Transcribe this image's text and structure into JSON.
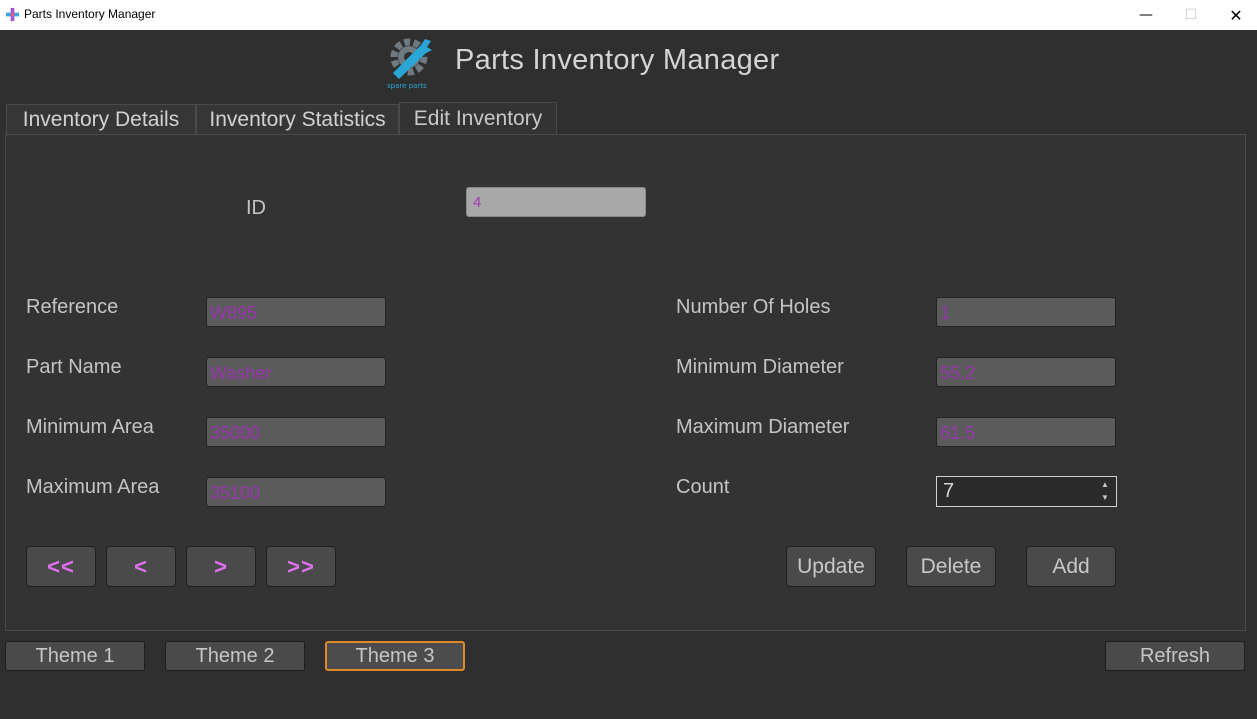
{
  "window": {
    "title": "Parts Inventory Manager",
    "minimize_glyph": "—",
    "maximize_glyph": "☐",
    "close_glyph": "✕"
  },
  "header": {
    "title": "Parts Inventory Manager",
    "logo_caption": "spare parts",
    "logo_icon": "gear-wrench-icon"
  },
  "tabs": [
    {
      "label": "Inventory Details"
    },
    {
      "label": "Inventory Statistics"
    },
    {
      "label": "Edit Inventory",
      "selected": true
    }
  ],
  "form": {
    "id": {
      "label": "ID",
      "value": "4"
    },
    "reference": {
      "label": "Reference",
      "value": "W895"
    },
    "part_name": {
      "label": "Part Name",
      "value": "Washer"
    },
    "min_area": {
      "label": "Minimum Area",
      "value": "35000"
    },
    "max_area": {
      "label": "Maximum Area",
      "value": "35100"
    },
    "holes": {
      "label": "Number Of Holes",
      "value": "1"
    },
    "min_diameter": {
      "label": "Minimum Diameter",
      "value": "55.2"
    },
    "max_diameter": {
      "label": "Maximum Diameter",
      "value": "61.5"
    },
    "count": {
      "label": "Count",
      "value": "7"
    }
  },
  "navigation": {
    "first": "<<",
    "prev": "<",
    "next": ">",
    "last": ">>"
  },
  "actions": {
    "update": "Update",
    "delete": "Delete",
    "add": "Add"
  },
  "themes": {
    "theme1": "Theme 1",
    "theme2": "Theme 2",
    "theme3": "Theme 3",
    "active": "Theme 3"
  },
  "refresh": "Refresh",
  "colors": {
    "background": "#2f2f2f",
    "field_text": "#9a36b0",
    "nav_text": "#e070f0",
    "active_theme_border": "#e08a2c",
    "logo_accent": "#2aa6d6"
  }
}
